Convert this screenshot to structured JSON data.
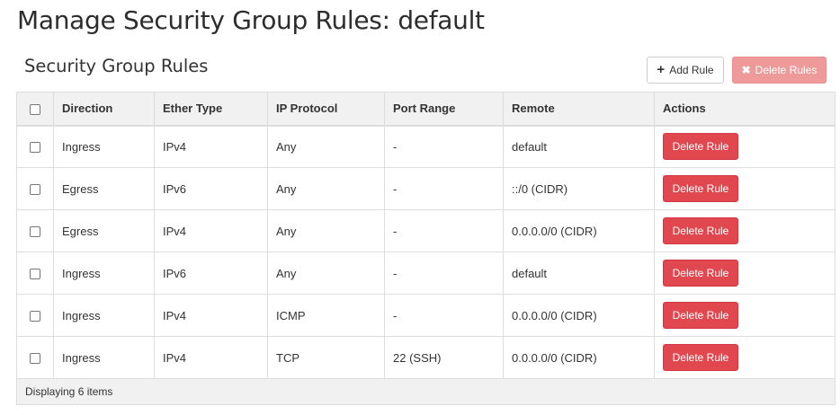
{
  "page": {
    "title": "Manage Security Group Rules: default"
  },
  "section": {
    "title": "Security Group Rules"
  },
  "toolbar": {
    "add_label": "Add Rule",
    "add_icon": "plus-icon",
    "delete_label": "Delete Rules",
    "delete_icon": "x-icon",
    "delete_enabled": false
  },
  "table": {
    "columns": [
      "Direction",
      "Ether Type",
      "IP Protocol",
      "Port Range",
      "Remote",
      "Actions"
    ],
    "rows": [
      {
        "direction": "Ingress",
        "ether_type": "IPv4",
        "ip_protocol": "Any",
        "port_range": "-",
        "remote": "default",
        "action": "Delete Rule"
      },
      {
        "direction": "Egress",
        "ether_type": "IPv6",
        "ip_protocol": "Any",
        "port_range": "-",
        "remote": "::/0 (CIDR)",
        "action": "Delete Rule"
      },
      {
        "direction": "Egress",
        "ether_type": "IPv4",
        "ip_protocol": "Any",
        "port_range": "-",
        "remote": "0.0.0.0/0 (CIDR)",
        "action": "Delete Rule"
      },
      {
        "direction": "Ingress",
        "ether_type": "IPv6",
        "ip_protocol": "Any",
        "port_range": "-",
        "remote": "default",
        "action": "Delete Rule"
      },
      {
        "direction": "Ingress",
        "ether_type": "IPv4",
        "ip_protocol": "ICMP",
        "port_range": "-",
        "remote": "0.0.0.0/0 (CIDR)",
        "action": "Delete Rule"
      },
      {
        "direction": "Ingress",
        "ether_type": "IPv4",
        "ip_protocol": "TCP",
        "port_range": "22 (SSH)",
        "remote": "0.0.0.0/0 (CIDR)",
        "action": "Delete Rule"
      }
    ],
    "footer": "Displaying 6 items"
  },
  "colors": {
    "danger": "#e0474f",
    "danger_disabled": "#ee9a9a",
    "header_bg": "#f1f1f1",
    "border": "#dddddd"
  }
}
